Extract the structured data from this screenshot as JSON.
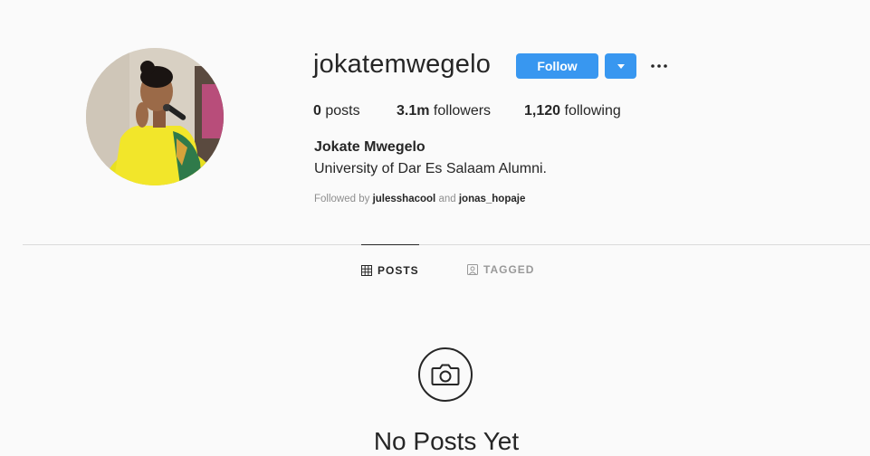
{
  "profile": {
    "username": "jokatemwegelo",
    "full_name": "Jokate Mwegelo",
    "bio": "University of Dar Es Salaam Alumni.",
    "follow_label": "Follow"
  },
  "stats": {
    "posts_count": "0",
    "posts_label": "posts",
    "followers_count": "3.1m",
    "followers_label": "followers",
    "following_count": "1,120",
    "following_label": "following"
  },
  "followed_by": {
    "prefix": "Followed by",
    "user1": "julesshacool",
    "conjunction": "and",
    "user2": "jonas_hopaje"
  },
  "tabs": [
    {
      "label": "POSTS",
      "icon": "grid-icon",
      "active": true
    },
    {
      "label": "TAGGED",
      "icon": "tagged-icon",
      "active": false
    }
  ],
  "empty_state": {
    "icon": "camera-icon",
    "title": "No Posts Yet"
  },
  "colors": {
    "accent": "#3897f0",
    "background": "#fafafa",
    "text": "#262626",
    "muted": "#8e8e8e"
  }
}
